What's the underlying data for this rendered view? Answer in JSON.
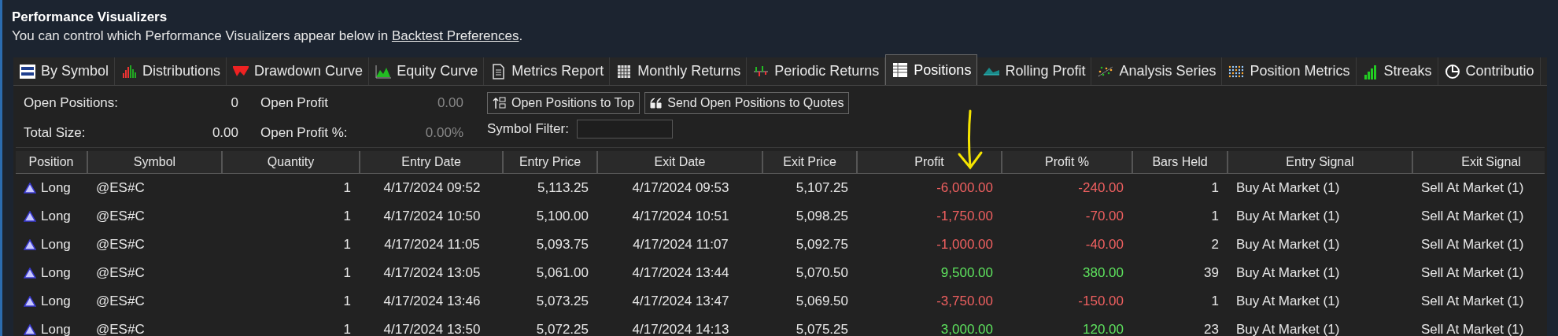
{
  "header": {
    "title": "Performance Visualizers",
    "note": "You can control which Performance Visualizers appear below in ",
    "link": "Backtest Preferences",
    "note_end": "."
  },
  "tabs": [
    {
      "label": "By Symbol",
      "selected": false
    },
    {
      "label": "Distributions",
      "selected": false
    },
    {
      "label": "Drawdown Curve",
      "selected": false
    },
    {
      "label": "Equity Curve",
      "selected": false
    },
    {
      "label": "Metrics Report",
      "selected": false
    },
    {
      "label": "Monthly Returns",
      "selected": false
    },
    {
      "label": "Periodic Returns",
      "selected": false
    },
    {
      "label": "Positions",
      "selected": true
    },
    {
      "label": "Rolling Profit",
      "selected": false
    },
    {
      "label": "Analysis Series",
      "selected": false
    },
    {
      "label": "Position Metrics",
      "selected": false
    },
    {
      "label": "Streaks",
      "selected": false
    },
    {
      "label": "Contributio",
      "selected": false
    }
  ],
  "summary": [
    {
      "label": "Open Positions:",
      "value": "0"
    },
    {
      "label": "Total Size:",
      "value": "0.00"
    }
  ],
  "open_profit": [
    {
      "label": "Open Profit",
      "value": "0.00"
    },
    {
      "label": "Open Profit %:",
      "value": "0.00%"
    }
  ],
  "buttons": [
    {
      "label": "Open Positions to Top"
    },
    {
      "label": "Send Open Positions to Quotes"
    }
  ],
  "symbol_filter": {
    "label": "Symbol Filter:"
  },
  "table": {
    "columns": [
      "Position",
      "Symbol",
      "Quantity",
      "Entry Date",
      "Entry Price",
      "Exit Date",
      "Exit Price",
      "Profit",
      "Profit %",
      "Bars Held",
      "Entry Signal",
      "Exit Signal"
    ],
    "rows": [
      {
        "kind": "loss",
        "cells": [
          "Long",
          "@ES#C",
          "1",
          "4/17/2024 09:52",
          "5,113.25",
          "4/17/2024 09:53",
          "5,107.25",
          "-6,000.00",
          "-240.00",
          "1",
          "Buy At Market (1)",
          "Sell At Market (1)"
        ]
      },
      {
        "kind": "loss",
        "cells": [
          "Long",
          "@ES#C",
          "1",
          "4/17/2024 10:50",
          "5,100.00",
          "4/17/2024 10:51",
          "5,098.25",
          "-1,750.00",
          "-70.00",
          "1",
          "Buy At Market (1)",
          "Sell At Market (1)"
        ]
      },
      {
        "kind": "loss",
        "cells": [
          "Long",
          "@ES#C",
          "1",
          "4/17/2024 11:05",
          "5,093.75",
          "4/17/2024 11:07",
          "5,092.75",
          "-1,000.00",
          "-40.00",
          "2",
          "Buy At Market (1)",
          "Sell At Market (1)"
        ]
      },
      {
        "kind": "gain",
        "cells": [
          "Long",
          "@ES#C",
          "1",
          "4/17/2024 13:05",
          "5,061.00",
          "4/17/2024 13:44",
          "5,070.50",
          "9,500.00",
          "380.00",
          "39",
          "Buy At Market (1)",
          "Sell At Market (1)"
        ]
      },
      {
        "kind": "loss",
        "cells": [
          "Long",
          "@ES#C",
          "1",
          "4/17/2024 13:46",
          "5,073.25",
          "4/17/2024 13:47",
          "5,069.50",
          "-3,750.00",
          "-150.00",
          "1",
          "Buy At Market (1)",
          "Sell At Market (1)"
        ]
      },
      {
        "kind": "gain",
        "cells": [
          "Long",
          "@ES#C",
          "1",
          "4/17/2024 13:50",
          "5,072.25",
          "4/17/2024 14:13",
          "5,075.25",
          "3,000.00",
          "120.00",
          "23",
          "Buy At Market (1)",
          "Sell At Market (1)"
        ]
      }
    ]
  },
  "annotation": {
    "kind": "arrow",
    "color": "#f5e400"
  }
}
